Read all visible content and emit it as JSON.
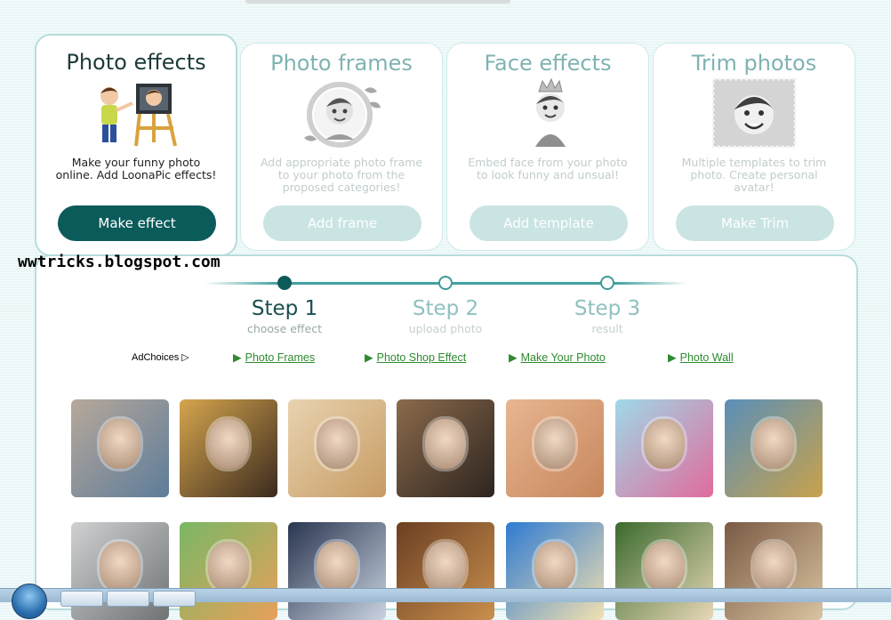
{
  "cards": [
    {
      "title": "Photo effects",
      "desc": "Make your funny photo online. Add LoonaPic effects!",
      "button": "Make effect",
      "image": "painter-boy-illustration"
    },
    {
      "title": "Photo frames",
      "desc": "Add appropriate photo frame to your photo from the proposed categories!",
      "button": "Add frame",
      "image": "framed-boy-illustration"
    },
    {
      "title": "Face effects",
      "desc": "Embed face from your photo to look funny and unsual!",
      "button": "Add template",
      "image": "crowned-boy-illustration"
    },
    {
      "title": "Trim photos",
      "desc": "Multiple templates to trim photo. Create personal avatar!",
      "button": "Make Trim",
      "image": "stamp-boy-illustration"
    }
  ],
  "watermark": "wwtricks.blogspot.com",
  "steps": [
    {
      "title": "Step 1",
      "sub": "choose effect",
      "active": true
    },
    {
      "title": "Step 2",
      "sub": "upload photo",
      "active": false
    },
    {
      "title": "Step 3",
      "sub": "result",
      "active": false
    }
  ],
  "ads": {
    "choices": "AdChoices",
    "links": [
      "Photo Frames",
      "Photo Shop Effect",
      "Make Your Photo",
      "Photo Wall"
    ]
  },
  "colors": {
    "accent": "#0c5b5b",
    "link": "#2f8a30",
    "disabled_button": "#c9e4e3"
  },
  "gallery": [
    {
      "name": "graffiti-wall-effect",
      "c1": "#b7a89a",
      "c2": "#5d7c9a"
    },
    {
      "name": "magazine-reader-effect",
      "c1": "#d6a64e",
      "c2": "#3b2a1e"
    },
    {
      "name": "golden-frame-effect",
      "c1": "#e8d3b0",
      "c2": "#c79b63"
    },
    {
      "name": "street-poster-effect",
      "c1": "#8b6a4b",
      "c2": "#2d2520"
    },
    {
      "name": "puzzle-effect",
      "c1": "#e7b690",
      "c2": "#c7865d"
    },
    {
      "name": "gift-box-frame-effect",
      "c1": "#9fd9e8",
      "c2": "#e06b9c"
    },
    {
      "name": "times-square-billboard-effect",
      "c1": "#5a8fb8",
      "c2": "#c9a24b"
    },
    {
      "name": "photo-print-effect",
      "c1": "#cfd1d2",
      "c2": "#6f7374"
    },
    {
      "name": "flower-frame-effect",
      "c1": "#79b765",
      "c2": "#e8a05a"
    },
    {
      "name": "superhero-shirt-effect",
      "c1": "#2a3550",
      "c2": "#c9d3e0"
    },
    {
      "name": "vintage-room-effect",
      "c1": "#6b3f22",
      "c2": "#c98f4d"
    },
    {
      "name": "beach-palm-effect",
      "c1": "#2f7bd2",
      "c2": "#f2e0b0"
    },
    {
      "name": "flower-wreath-effect",
      "c1": "#3b6a2e",
      "c2": "#e7d7b6"
    },
    {
      "name": "tea-table-effect",
      "c1": "#7a5a44",
      "c2": "#d9c3a0"
    }
  ]
}
